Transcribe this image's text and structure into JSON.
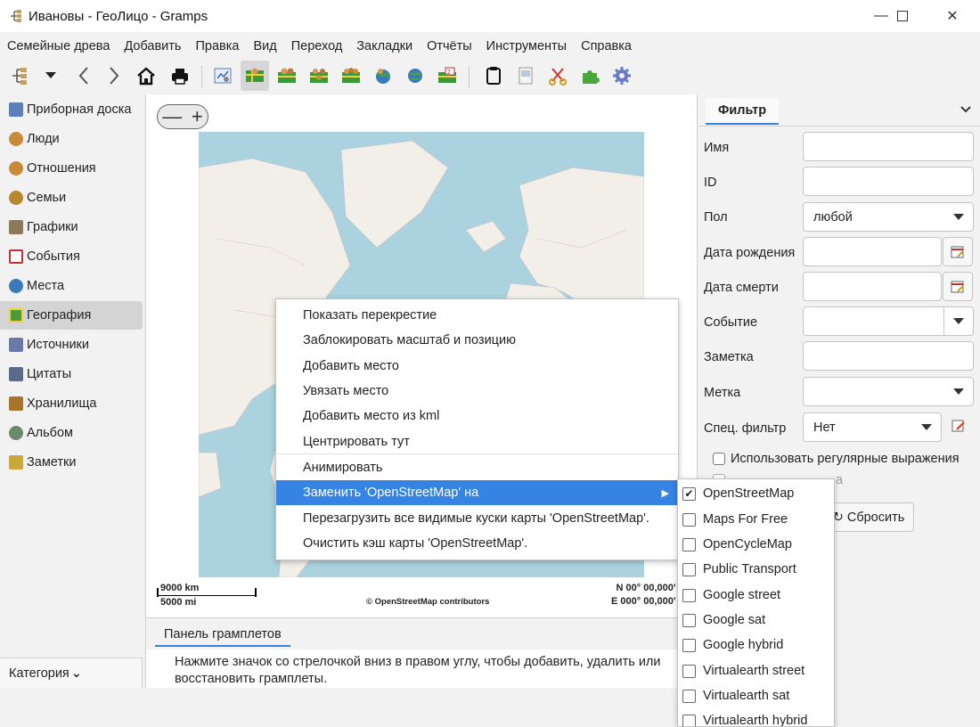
{
  "window": {
    "title": "Ивановы - ГеоЛицо - Gramps",
    "minimize": "—",
    "maximize": "☐",
    "close": "✕"
  },
  "menubar": [
    "Семейные древа",
    "Добавить",
    "Правка",
    "Вид",
    "Переход",
    "Закладки",
    "Отчёты",
    "Инструменты",
    "Справка"
  ],
  "sidebar": {
    "items": [
      {
        "label": "Приборная доска",
        "icon": "dashboard-icon",
        "color": "#5b7fb8"
      },
      {
        "label": "Люди",
        "icon": "person-icon",
        "color": "#c98a3a"
      },
      {
        "label": "Отношения",
        "icon": "relationships-icon",
        "color": "#c98a3a"
      },
      {
        "label": "Семьи",
        "icon": "family-icon",
        "color": "#b8862d"
      },
      {
        "label": "Графики",
        "icon": "chart-icon",
        "color": "#8a7a5a"
      },
      {
        "label": "События",
        "icon": "calendar-icon",
        "color": "#b33"
      },
      {
        "label": "Места",
        "icon": "globe-icon",
        "color": "#3a7ab8"
      },
      {
        "label": "География",
        "icon": "map-icon",
        "color": "#4a9a3a"
      },
      {
        "label": "Источники",
        "icon": "source-icon",
        "color": "#6a7aa8"
      },
      {
        "label": "Цитаты",
        "icon": "citation-icon",
        "color": "#5a6a8a"
      },
      {
        "label": "Хранилища",
        "icon": "repository-icon",
        "color": "#a8742a"
      },
      {
        "label": "Альбом",
        "icon": "album-icon",
        "color": "#6a8a6a"
      },
      {
        "label": "Заметки",
        "icon": "notes-icon",
        "color": "#c8a838"
      }
    ],
    "active_index": 7,
    "category_label": "Категория",
    "category_arrow": "⌄"
  },
  "map": {
    "zoom_out": "—",
    "zoom_in": "+",
    "scale_km": "9000 km",
    "scale_mi": "5000 mi",
    "attribution": "© OpenStreetMap contributors",
    "coord_lat": "N 00° 00,000'",
    "coord_lon": "E 000° 00,000'"
  },
  "gramplets": {
    "tab_label": "Панель грамплетов",
    "hint": "Нажмите значок со стрелочкой вниз в правом углу, чтобы добавить, удалить или восстановить грамплеты."
  },
  "filter": {
    "tab_label": "Фильтр",
    "collapse_icon": "⌄",
    "fields": {
      "name": "Имя",
      "id": "ID",
      "gender": "Пол",
      "gender_value": "любой",
      "birth": "Дата рождения",
      "death": "Дата смерти",
      "event": "Событие",
      "note": "Заметка",
      "tag": "Метка",
      "custom": "Спец. фильтр",
      "custom_value": "Нет"
    },
    "regex_label": "Использовать регулярные выражения",
    "hidden_check_partial": "а",
    "reset_label": "Сбросить",
    "reset_icon": "↻"
  },
  "context_menu": {
    "items": [
      "Показать перекрестие",
      "Заблокировать масштаб и позицию",
      "Добавить место",
      "Увязать место",
      "Добавить место из kml",
      "Центрировать тут",
      "Анимировать",
      "Заменить 'OpenStreetMap' на",
      "Перезагрузить все видимые куски карты 'OpenStreetMap'.",
      "Очистить кэш карты 'OpenStreetMap'."
    ],
    "highlighted_index": 7,
    "submenu_arrow": "▶"
  },
  "submenu": {
    "items": [
      {
        "label": "OpenStreetMap",
        "checked": true
      },
      {
        "label": "Maps For Free",
        "checked": false
      },
      {
        "label": "OpenCycleMap",
        "checked": false
      },
      {
        "label": "Public Transport",
        "checked": false
      },
      {
        "label": "Google street",
        "checked": false
      },
      {
        "label": "Google sat",
        "checked": false
      },
      {
        "label": "Google hybrid",
        "checked": false
      },
      {
        "label": "Virtualearth street",
        "checked": false
      },
      {
        "label": "Virtualearth sat",
        "checked": false
      },
      {
        "label": "Virtualearth hybrid",
        "checked": false
      }
    ],
    "check_mark": "✔"
  },
  "colors": {
    "accent": "#3584e4",
    "water": "#aad3df",
    "land": "#f2efe9"
  }
}
